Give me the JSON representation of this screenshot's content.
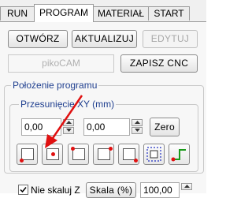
{
  "tabs": [
    {
      "label": "RUN"
    },
    {
      "label": "PROGRAM"
    },
    {
      "label": "MATERIAŁ"
    },
    {
      "label": "START"
    }
  ],
  "buttons": {
    "open": "OTWÓRZ",
    "update": "AKTUALIZUJ",
    "edit": "EDYTUJ",
    "save_cnc": "ZAPISZ CNC",
    "zero": "Zero",
    "scale": "Skala (%)"
  },
  "program_name": "pikoCAM",
  "position_group": {
    "title": "Położenie programu",
    "offset_title": "Przesunięcie XY (mm)",
    "offset_x": "0,00",
    "offset_y": "0,00"
  },
  "no_scale": {
    "label": "Nie skaluj Z",
    "checked": true
  },
  "scale_value": "100,00",
  "colors": {
    "group_title": "#1f3f8f",
    "annotation_arrow": "#e01010",
    "origin_dot": "#e01010",
    "icon_green": "#1a9a1a",
    "icon_blue": "#2030c0"
  }
}
